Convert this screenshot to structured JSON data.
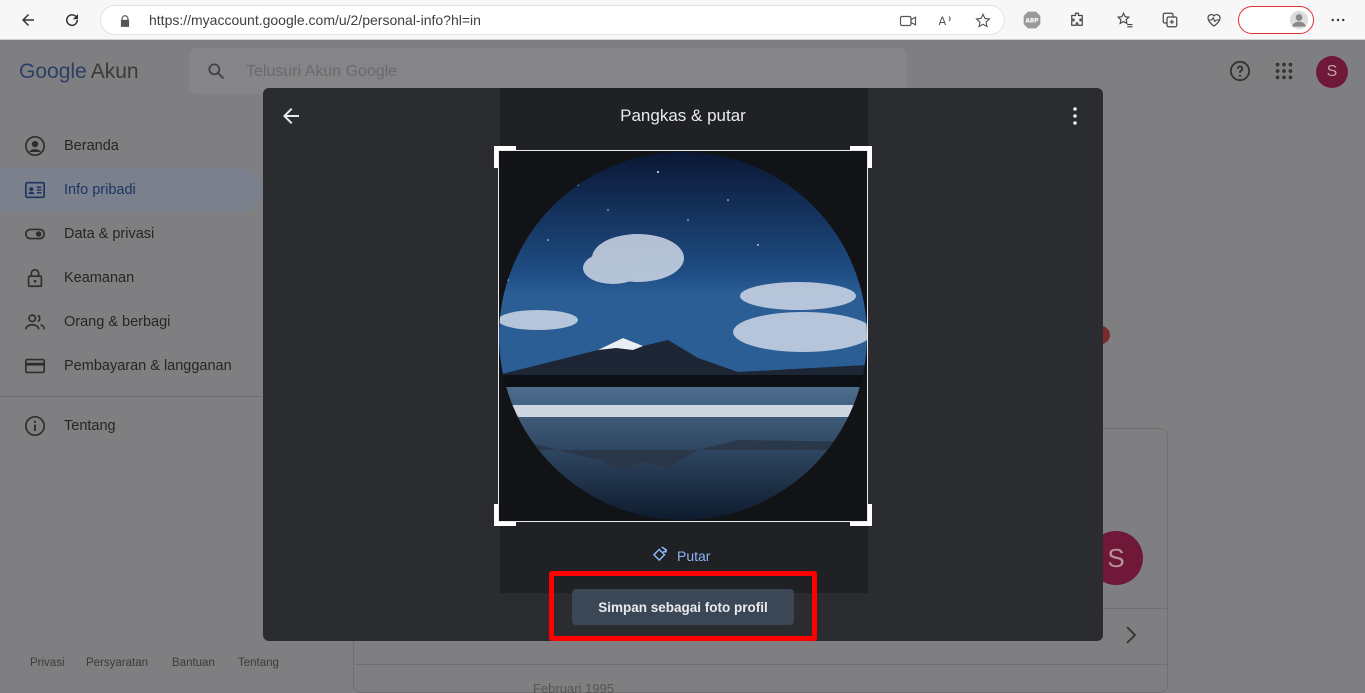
{
  "browser": {
    "url": "https://myaccount.google.com/u/2/personal-info?hl=in"
  },
  "header": {
    "logo_google": "Google",
    "logo_akun": "Akun",
    "search_placeholder": "Telusuri Akun Google",
    "avatar_letter": "S"
  },
  "sidebar": {
    "items": [
      {
        "label": "Beranda",
        "icon": "account-circle-icon"
      },
      {
        "label": "Info pribadi",
        "icon": "id-card-icon",
        "active": true
      },
      {
        "label": "Data & privasi",
        "icon": "toggle-icon"
      },
      {
        "label": "Keamanan",
        "icon": "lock-icon"
      },
      {
        "label": "Orang & berbagi",
        "icon": "people-icon"
      },
      {
        "label": "Pembayaran & langganan",
        "icon": "credit-card-icon"
      },
      {
        "label": "Tentang",
        "icon": "info-icon"
      }
    ]
  },
  "footer": {
    "links": [
      "Privasi",
      "Persyaratan",
      "Bantuan",
      "Tentang"
    ]
  },
  "background": {
    "row_text": "Februari 1995",
    "avatar_letter": "S"
  },
  "modal": {
    "title": "Pangkas & putar",
    "rotate_label": "Putar",
    "save_label": "Simpan sebagai foto profil"
  },
  "colors": {
    "accent": "#8ab4f8",
    "highlight": "#ff0000",
    "modal_bg": "#2b2c30",
    "save_button": "#3c4756"
  }
}
